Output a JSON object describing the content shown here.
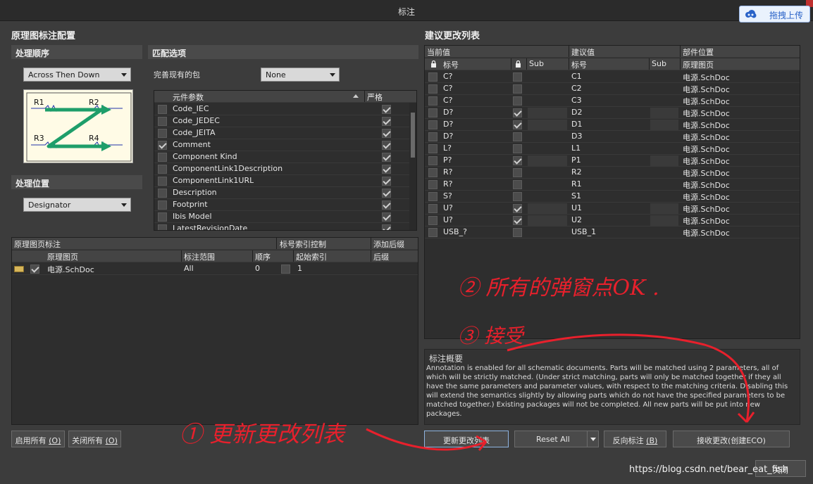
{
  "window": {
    "title": "标注",
    "upload_button": "拖拽上传"
  },
  "left_heading": "原理图标注配置",
  "right_heading": "建议更改列表",
  "order": {
    "title": "处理顺序",
    "value": "Across Then Down",
    "diagram_labels": [
      "R1",
      "R2",
      "R3",
      "R4"
    ]
  },
  "position": {
    "title": "处理位置",
    "value": "Designator"
  },
  "match": {
    "title": "匹配选项",
    "complete_label": "完善现有的包",
    "complete_value": "None",
    "columns": [
      "元件参数",
      "严格"
    ],
    "params": [
      {
        "name": "Code_IEC",
        "checked": false,
        "strict": true
      },
      {
        "name": "Code_JEDEC",
        "checked": false,
        "strict": true
      },
      {
        "name": "Code_JEITA",
        "checked": false,
        "strict": true
      },
      {
        "name": "Comment",
        "checked": true,
        "strict": true
      },
      {
        "name": "Component Kind",
        "checked": false,
        "strict": true
      },
      {
        "name": "ComponentLink1Description",
        "checked": false,
        "strict": true
      },
      {
        "name": "ComponentLink1URL",
        "checked": false,
        "strict": true
      },
      {
        "name": "Description",
        "checked": false,
        "strict": true
      },
      {
        "name": "Footprint",
        "checked": false,
        "strict": true
      },
      {
        "name": "Ibis Model",
        "checked": false,
        "strict": true
      },
      {
        "name": "LatestRevisionDate",
        "checked": false,
        "strict": true
      }
    ]
  },
  "sheets": {
    "groups": [
      "原理图页标注",
      "标号索引控制",
      "添加后缀"
    ],
    "columns": [
      "原理图页",
      "标注范围",
      "顺序",
      "起始索引",
      "后缀"
    ],
    "rows": [
      {
        "sheet": "电源.SchDoc",
        "scope": "All",
        "order": "0",
        "start": "1",
        "checked": true
      }
    ]
  },
  "changes": {
    "groups": [
      "当前值",
      "建议值",
      "部件位置"
    ],
    "columns": [
      "标号",
      "Sub",
      "标号",
      "Sub",
      "原理图页"
    ],
    "rows": [
      {
        "cur": "C?",
        "locked": false,
        "new": "C1",
        "sheet": "电源.SchDoc"
      },
      {
        "cur": "C?",
        "locked": false,
        "new": "C2",
        "sheet": "电源.SchDoc"
      },
      {
        "cur": "C?",
        "locked": false,
        "new": "C3",
        "sheet": "电源.SchDoc"
      },
      {
        "cur": "D?",
        "locked": true,
        "new": "D2",
        "sheet": "电源.SchDoc"
      },
      {
        "cur": "D?",
        "locked": true,
        "new": "D1",
        "sheet": "电源.SchDoc"
      },
      {
        "cur": "D?",
        "locked": false,
        "new": "D3",
        "sheet": "电源.SchDoc"
      },
      {
        "cur": "L?",
        "locked": false,
        "new": "L1",
        "sheet": "电源.SchDoc"
      },
      {
        "cur": "P?",
        "locked": true,
        "new": "P1",
        "sheet": "电源.SchDoc"
      },
      {
        "cur": "R?",
        "locked": false,
        "new": "R2",
        "sheet": "电源.SchDoc"
      },
      {
        "cur": "R?",
        "locked": false,
        "new": "R1",
        "sheet": "电源.SchDoc"
      },
      {
        "cur": "S?",
        "locked": false,
        "new": "S1",
        "sheet": "电源.SchDoc"
      },
      {
        "cur": "U?",
        "locked": true,
        "new": "U1",
        "sheet": "电源.SchDoc"
      },
      {
        "cur": "U?",
        "locked": true,
        "new": "U2",
        "sheet": "电源.SchDoc"
      },
      {
        "cur": "USB_?",
        "locked": false,
        "new": "USB_1",
        "sheet": "电源.SchDoc"
      }
    ]
  },
  "summary": {
    "title": "标注概要",
    "text": "Annotation is enabled for all schematic documents. Parts will be matched using 2 parameters, all of which will be strictly matched. (Under strict matching, parts will only be matched together if they all have the same parameters and parameter values, with respect to the matching criteria. Disabling this will extend the semantics slightly by allowing parts which do not have the specified parameters to be matched together.) Existing packages will not be completed. All new parts will be put into new packages."
  },
  "buttons": {
    "enable_all": "启用所有",
    "enable_all_key": "(O)",
    "disable_all": "关闭所有",
    "disable_all_key": "(O)",
    "update": "更新更改列表",
    "reset": "Reset All",
    "reverse": "反向标注",
    "reverse_key": "(B)",
    "accept": "接收更改(创建ECO)",
    "close": "关闭"
  },
  "annotations": {
    "note1": "① 更新更改列表",
    "note2": "② 所有的弹窗点OK .",
    "note3": "③ 接受"
  },
  "watermark": "https://blog.csdn.net/bear_eat_fish",
  "colors": {
    "ink": "#e8202c",
    "accent": "#2a63c8",
    "arrow": "#1e9e6a"
  }
}
